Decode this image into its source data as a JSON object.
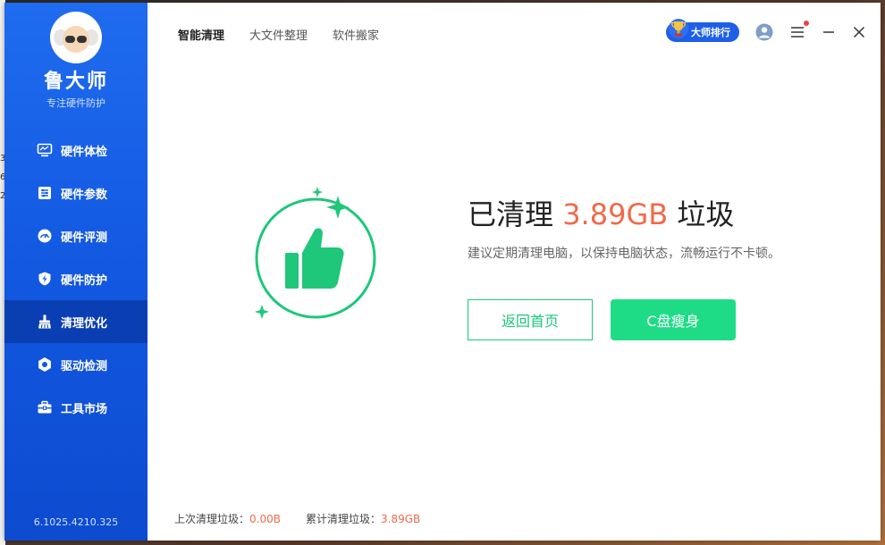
{
  "background_left_chars": [
    "3",
    "6",
    "2"
  ],
  "brand": {
    "name": "鲁大师",
    "subtitle": "专注硬件防护"
  },
  "nav": [
    {
      "label": "硬件体检",
      "icon": "monitor-icon"
    },
    {
      "label": "硬件参数",
      "icon": "sliders-icon"
    },
    {
      "label": "硬件评测",
      "icon": "speedometer-icon"
    },
    {
      "label": "硬件防护",
      "icon": "shield-bolt-icon"
    },
    {
      "label": "清理优化",
      "icon": "broom-icon",
      "active": true
    },
    {
      "label": "驱动检测",
      "icon": "gear-icon"
    },
    {
      "label": "工具市场",
      "icon": "toolbox-icon"
    }
  ],
  "version": "6.1025.4210.325",
  "tabs": [
    {
      "label": "智能清理",
      "active": true
    },
    {
      "label": "大文件整理"
    },
    {
      "label": "软件搬家"
    }
  ],
  "header": {
    "rank_label": "大师排行"
  },
  "result": {
    "title_prefix": "已清理 ",
    "amount": "3.89GB",
    "title_suffix": " 垃圾",
    "desc": "建议定期清理电脑，以保持电脑状态，流畅运行不卡顿。",
    "back_label": "返回首页",
    "slim_label": "C盘瘦身"
  },
  "footer": {
    "last_label": "上次清理垃圾：",
    "last_value": "0.00B",
    "total_label": "累计清理垃圾：",
    "total_value": "3.89GB"
  },
  "colors": {
    "sidebar": "#1258e0",
    "accent_green": "#1ec77a",
    "highlight": "#f06a4a"
  }
}
